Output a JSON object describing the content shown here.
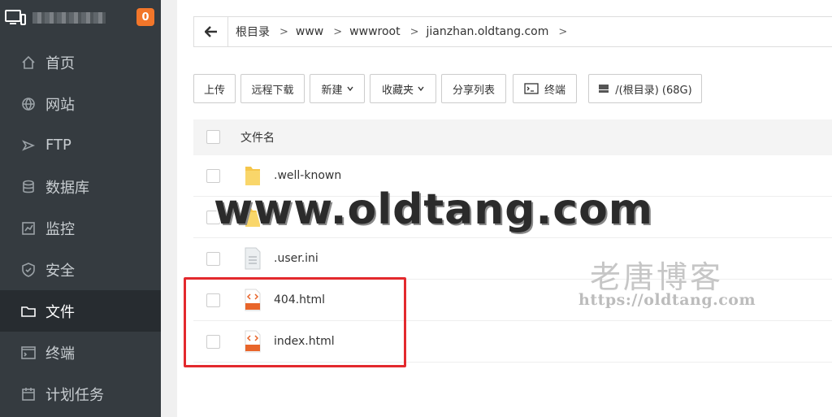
{
  "sidebar": {
    "badge": "0",
    "items": [
      {
        "label": "首页",
        "icon": "home-icon"
      },
      {
        "label": "网站",
        "icon": "globe-icon"
      },
      {
        "label": "FTP",
        "icon": "ftp-icon"
      },
      {
        "label": "数据库",
        "icon": "database-icon"
      },
      {
        "label": "监控",
        "icon": "monitor-chart-icon"
      },
      {
        "label": "安全",
        "icon": "shield-icon"
      },
      {
        "label": "文件",
        "icon": "folder-icon",
        "active": true
      },
      {
        "label": "终端",
        "icon": "terminal-icon"
      },
      {
        "label": "计划任务",
        "icon": "calendar-icon"
      }
    ]
  },
  "breadcrumb": [
    "根目录",
    "www",
    "wwwroot",
    "jianzhan.oldtang.com"
  ],
  "toolbar": {
    "upload": "上传",
    "remote_download": "远程下载",
    "new": "新建",
    "favorites": "收藏夹",
    "share_list": "分享列表",
    "terminal": "终端",
    "disk": "/(根目录) (68G)"
  },
  "table": {
    "column_name": "文件名",
    "rows": [
      {
        "name": ".well-known",
        "type": "folder"
      },
      {
        "name": "",
        "type": "folder"
      },
      {
        "name": ".user.ini",
        "type": "file"
      },
      {
        "name": "404.html",
        "type": "html"
      },
      {
        "name": "index.html",
        "type": "html"
      }
    ]
  },
  "watermark": {
    "main": "www.oldtang.com",
    "cn": "老唐博客",
    "url": "https://oldtang.com"
  },
  "colors": {
    "sidebar_bg": "#353b40",
    "sidebar_active": "#272c30",
    "badge": "#f2762a",
    "highlight": "#e3292d"
  }
}
